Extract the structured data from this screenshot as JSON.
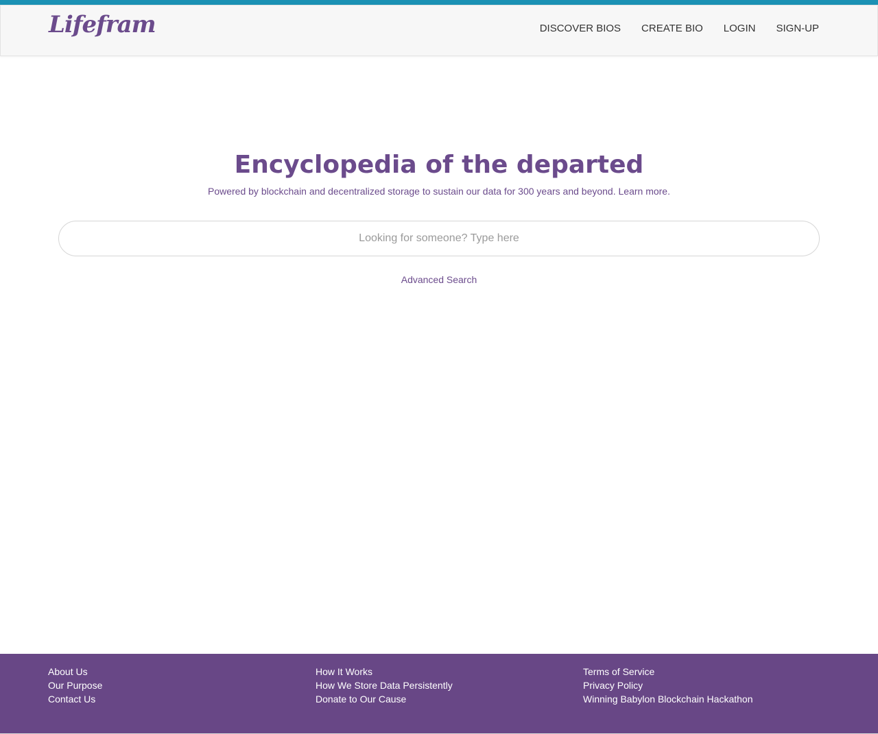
{
  "brand": {
    "logo_text": "Lifefram",
    "accent_color": "#6b4b8c",
    "topline_color": "#1b91b4"
  },
  "nav": {
    "items": [
      {
        "label": "DISCOVER BIOS"
      },
      {
        "label": "CREATE BIO"
      },
      {
        "label": "LOGIN"
      },
      {
        "label": "SIGN-UP"
      }
    ]
  },
  "hero": {
    "title": "Encyclopedia of the departed",
    "subtitle": "Powered by blockchain and decentralized storage to sustain our data for 300 years and beyond.",
    "learn_more": "Learn more."
  },
  "search": {
    "placeholder": "Looking for someone? Type here",
    "value": "",
    "advanced_label": "Advanced Search"
  },
  "footer": {
    "background": "#684786",
    "col1": [
      {
        "label": "About Us"
      },
      {
        "label": "Our Purpose"
      },
      {
        "label": "Contact Us"
      }
    ],
    "col2": [
      {
        "label": "How It Works"
      },
      {
        "label": "How We Store Data Persistently"
      },
      {
        "label": "Donate to Our Cause"
      }
    ],
    "col3": [
      {
        "label": "Terms of Service"
      },
      {
        "label": "Privacy Policy"
      },
      {
        "label": "Winning Babylon Blockchain Hackathon"
      }
    ]
  }
}
